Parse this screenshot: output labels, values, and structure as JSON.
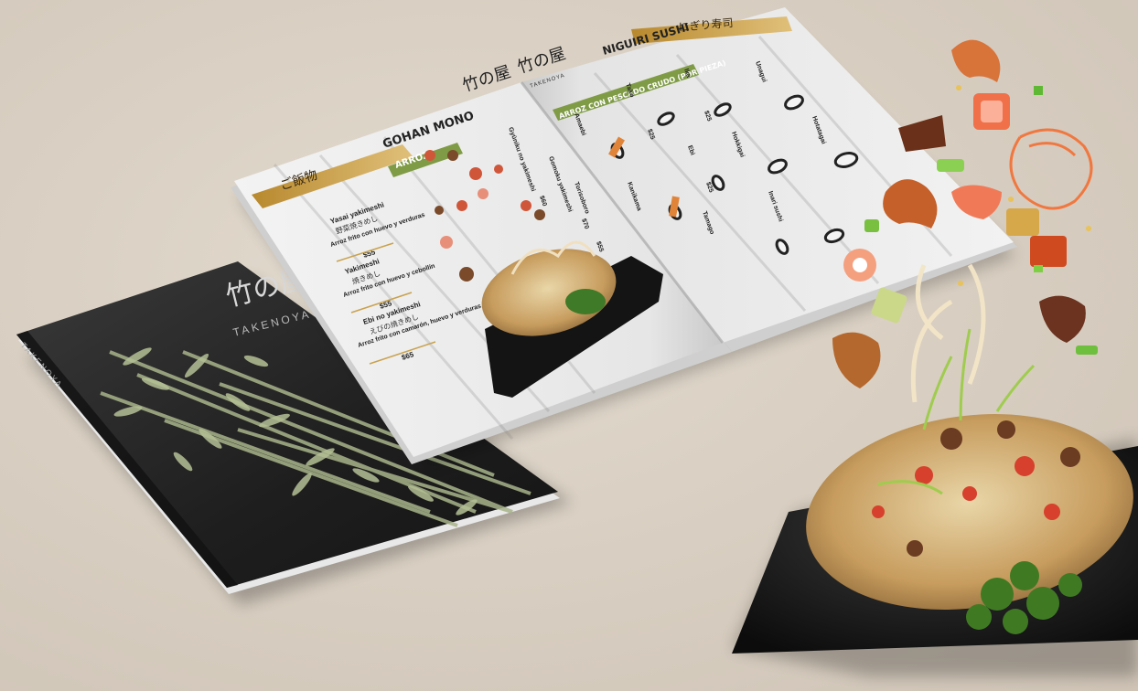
{
  "brand": {
    "name_jp": "竹の屋",
    "name_latin": "TAKENOYA"
  },
  "cover": {
    "spine_text": "TAKENOYA"
  },
  "left_page": {
    "header_jp": "ご飯物",
    "section_title": "GOHAN MONO",
    "subsection": "ARROZ",
    "items": [
      {
        "name": "Yasai yakimeshi",
        "jp": "野菜焼きめし",
        "desc": "Arroz frito con huevo y verduras",
        "price": "$55"
      },
      {
        "name": "Yakimeshi",
        "jp": "焼きめし",
        "desc": "Arroz frito con huevo y cebollín",
        "price": "$55"
      },
      {
        "name": "Ebi no yakimeshi",
        "jp": "えびの焼きめし",
        "desc": "Arroz frito con camarón, huevo y verduras",
        "price": "$65"
      }
    ],
    "items_mid": [
      {
        "name": "Gyūniku no yakimeshi",
        "price": "$60"
      },
      {
        "name": "Gomoku yakimeshi",
        "price": "$70"
      },
      {
        "name": "Torisoboro",
        "price": "$55"
      }
    ]
  },
  "right_page": {
    "header_jp": "にぎり寿司",
    "section_title": "NIGUIRI SUSHI",
    "subsection": "ARROZ CON PESCADO CRUDO (POR PIEZA)",
    "items": [
      {
        "name": "Amaebi",
        "price": "$"
      },
      {
        "name": "Tako",
        "price": "$25"
      },
      {
        "name": "Ika",
        "price": "$25"
      },
      {
        "name": "Unagui",
        "price": "$"
      },
      {
        "name": "Kanikama",
        "price": "$"
      },
      {
        "name": "Ebi",
        "price": "$25"
      },
      {
        "name": "Hokkigai",
        "price": "$"
      },
      {
        "name": "Hotatagai",
        "price": "$"
      },
      {
        "name": "Tamago",
        "price": "$"
      },
      {
        "name": "Inari sushi",
        "price": "$"
      }
    ]
  }
}
